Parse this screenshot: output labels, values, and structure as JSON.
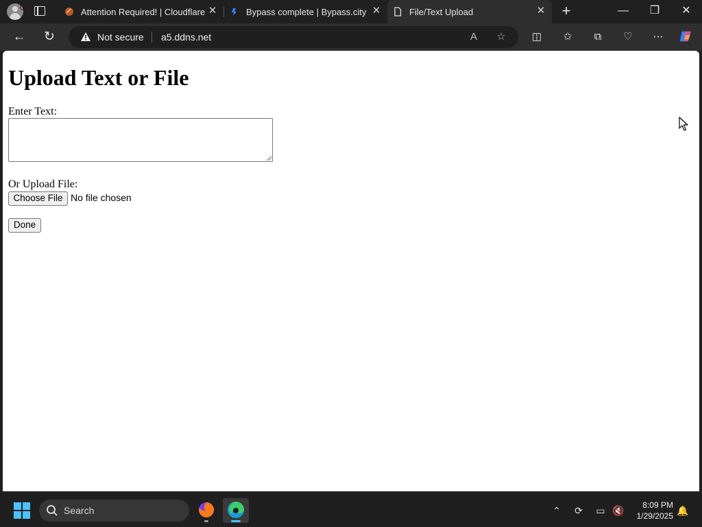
{
  "browser": {
    "tabs": [
      {
        "title": "Attention Required! | Cloudflare",
        "icon": "cloudflare-favicon"
      },
      {
        "title": "Bypass complete | Bypass.city",
        "icon": "bypass-favicon"
      },
      {
        "title": "File/Text Upload",
        "icon": "page-icon",
        "active": true
      }
    ],
    "address": {
      "security_label": "Not secure",
      "url": "a5.ddns.net"
    }
  },
  "page": {
    "heading": "Upload Text or File",
    "text_label": "Enter Text:",
    "text_value": "",
    "file_label": "Or Upload File:",
    "choose_file_button": "Choose File",
    "file_status": "No file chosen",
    "done_button": "Done"
  },
  "taskbar": {
    "search_placeholder": "Search",
    "time": "8:09 PM",
    "date": "1/29/2025"
  },
  "colors": {
    "chrome_dark": "#202020",
    "toolbar": "#2e2e2e",
    "accent": "#4cc2ff"
  }
}
